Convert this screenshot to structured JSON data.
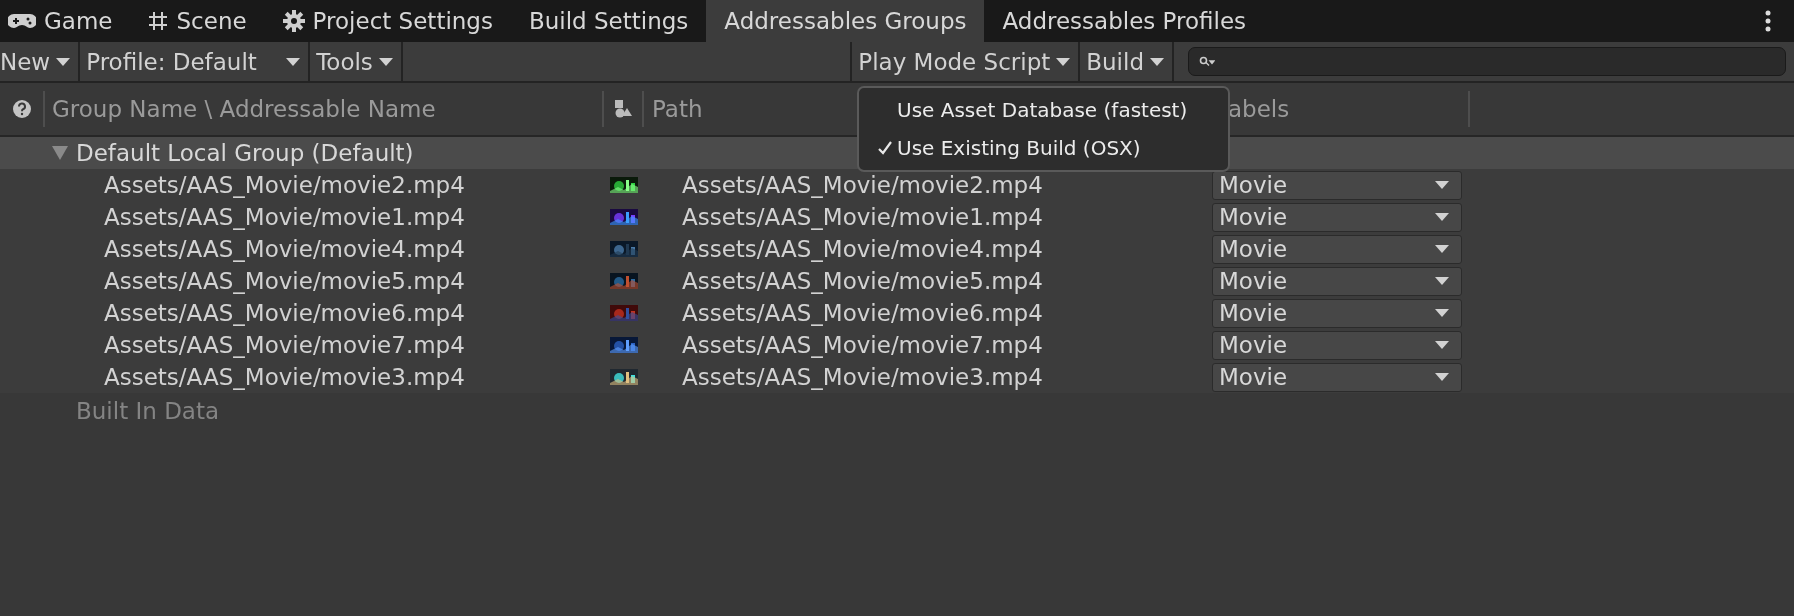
{
  "tabs": [
    {
      "label": "Game",
      "selected": false
    },
    {
      "label": "Scene",
      "selected": false
    },
    {
      "label": "Project Settings",
      "selected": false
    },
    {
      "label": "Build Settings",
      "selected": false
    },
    {
      "label": "Addressables Groups",
      "selected": true
    },
    {
      "label": "Addressables Profiles",
      "selected": false
    }
  ],
  "toolbar": {
    "left": [
      "New",
      "Profile: Default",
      "Tools"
    ],
    "right": [
      "Play Mode Script",
      "Build"
    ]
  },
  "table": {
    "columns": [
      "Group Name \\ Addressable Name",
      "Path",
      "abels"
    ],
    "groups": [
      {
        "name": "Default Local Group (Default)",
        "expanded": true,
        "children": [
          {
            "name": "Assets/AAS_Movie/movie2.mp4",
            "path": "Assets/AAS_Movie/movie2.mp4",
            "label": "Movie"
          },
          {
            "name": "Assets/AAS_Movie/movie1.mp4",
            "path": "Assets/AAS_Movie/movie1.mp4",
            "label": "Movie"
          },
          {
            "name": "Assets/AAS_Movie/movie4.mp4",
            "path": "Assets/AAS_Movie/movie4.mp4",
            "label": "Movie"
          },
          {
            "name": "Assets/AAS_Movie/movie5.mp4",
            "path": "Assets/AAS_Movie/movie5.mp4",
            "label": "Movie"
          },
          {
            "name": "Assets/AAS_Movie/movie6.mp4",
            "path": "Assets/AAS_Movie/movie6.mp4",
            "label": "Movie"
          },
          {
            "name": "Assets/AAS_Movie/movie7.mp4",
            "path": "Assets/AAS_Movie/movie7.mp4",
            "label": "Movie"
          },
          {
            "name": "Assets/AAS_Movie/movie3.mp4",
            "path": "Assets/AAS_Movie/movie3.mp4",
            "label": "Movie"
          }
        ]
      }
    ],
    "footer": "Built In Data"
  },
  "menu": [
    {
      "label": "Use Asset Database (fastest)",
      "checked": false
    },
    {
      "label": "Use Existing Build (OSX)",
      "checked": true
    }
  ]
}
